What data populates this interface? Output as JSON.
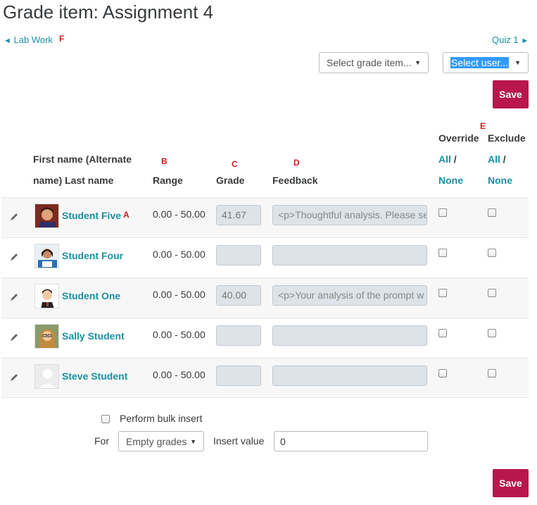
{
  "page": {
    "title": "Grade item: Assignment 4"
  },
  "nav": {
    "prev_arrow": "◄",
    "prev_label": "Lab Work",
    "next_label": "Quiz 1",
    "next_arrow": "►"
  },
  "annotations": {
    "a": "A",
    "b": "B",
    "c": "C",
    "d": "D",
    "e": "E",
    "f": "F"
  },
  "selectors": {
    "grade_item": "Select grade item...",
    "user": "Select user...",
    "caret": "▼"
  },
  "buttons": {
    "save": "Save"
  },
  "table": {
    "headers": {
      "name_line1": "First name (Alternate",
      "name_line2": "name) Last name",
      "range": "Range",
      "grade": "Grade",
      "feedback": "Feedback",
      "override": "Override",
      "exclude": "Exclude",
      "all": "All",
      "sep": "/",
      "none": "None"
    },
    "rows": [
      {
        "name": "Student Five",
        "range": "0.00 - 50.00",
        "grade": "41.67",
        "feedback": "<p>Thoughtful analysis. Please se"
      },
      {
        "name": "Student Four",
        "range": "0.00 - 50.00",
        "grade": "",
        "feedback": ""
      },
      {
        "name": "Student One",
        "range": "0.00 - 50.00",
        "grade": "40.00",
        "feedback": "<p>Your analysis of the prompt w"
      },
      {
        "name": "Sally Student",
        "range": "0.00 - 50.00",
        "grade": "",
        "feedback": ""
      },
      {
        "name": "Steve Student",
        "range": "0.00 - 50.00",
        "grade": "",
        "feedback": ""
      }
    ]
  },
  "bulk": {
    "checkbox_label": "Perform bulk insert",
    "for_label": "For",
    "for_value": "Empty grades",
    "insert_label": "Insert value",
    "insert_value": "0"
  },
  "colors": {
    "link": "#1a8fa5",
    "save": "#b8164c",
    "marker": "#d11b1b"
  }
}
